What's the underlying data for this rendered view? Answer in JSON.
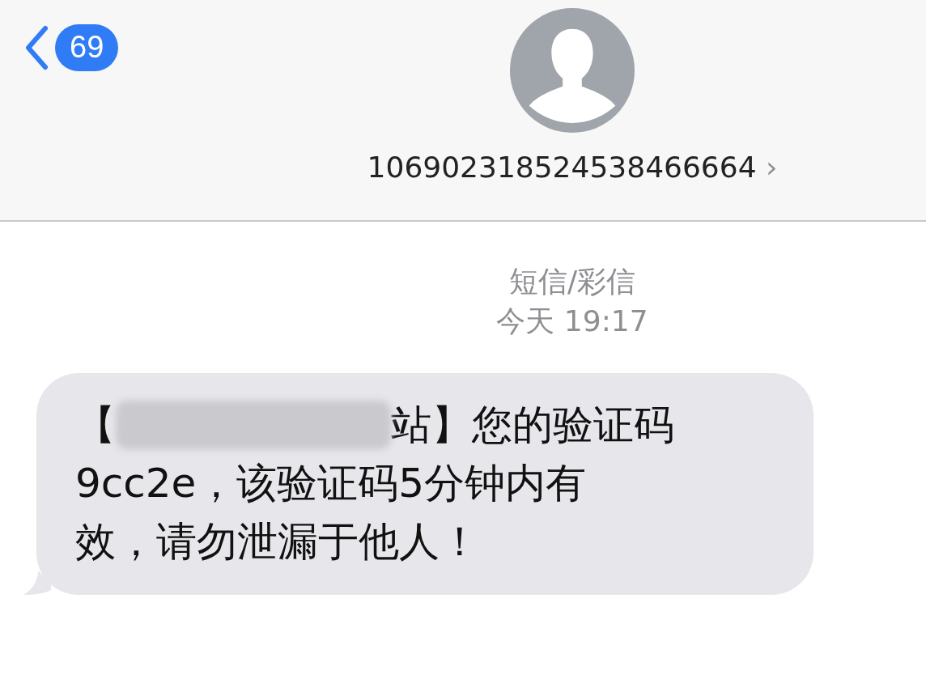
{
  "nav": {
    "back_count": "69",
    "contact": "106902318524538466664",
    "chevron": "›"
  },
  "conversation": {
    "service": "短信/彩信",
    "time": "今天 19:17"
  },
  "message": {
    "first_line": {
      "before": "【",
      "redacted": true,
      "after": "站】您的验证码"
    },
    "lines": [
      "9cc2e，该验证码5分钟内有",
      "效，请勿泄漏于他人！"
    ]
  }
}
